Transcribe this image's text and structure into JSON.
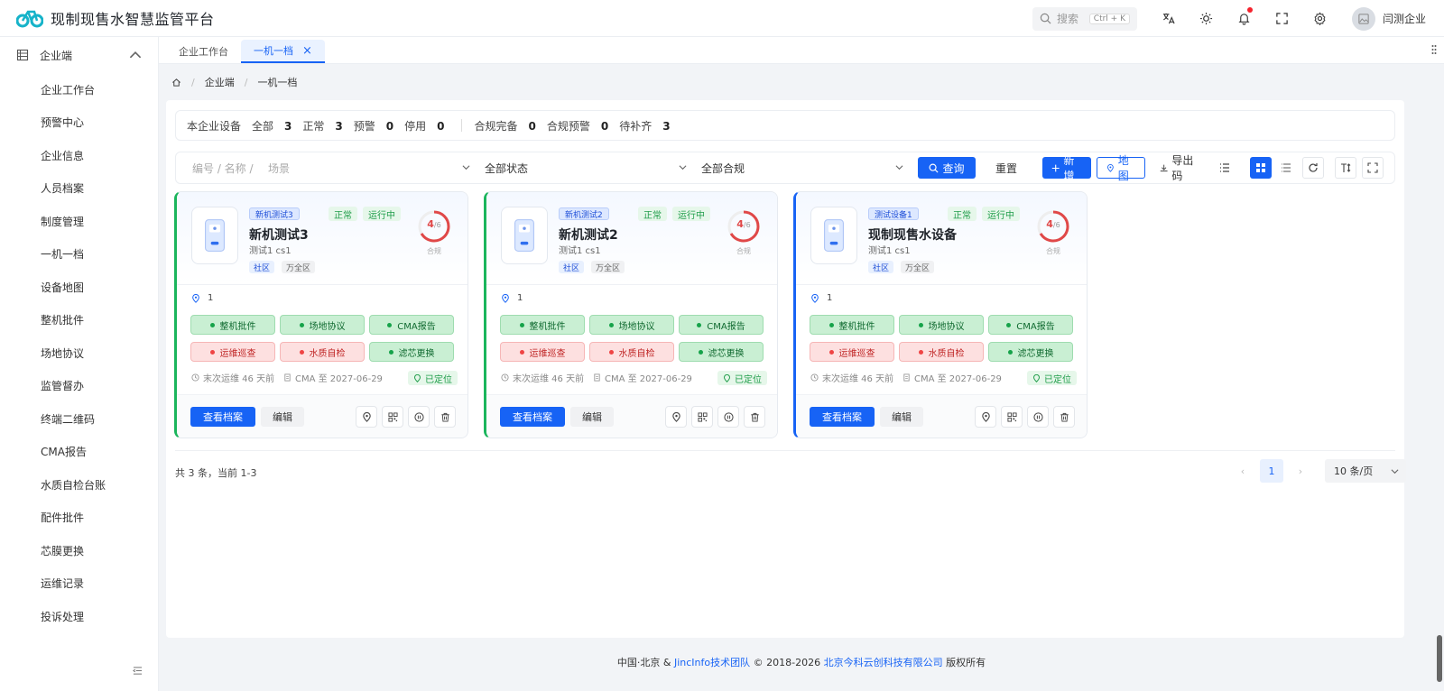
{
  "app": {
    "title": "现制现售水智慧监管平台",
    "brand_color": "#1763f5"
  },
  "header": {
    "search_placeholder": "搜索",
    "search_shortcut": "Ctrl + K",
    "icons": [
      "translate-icon",
      "theme-sun-icon",
      "bell-icon",
      "fullscreen-icon",
      "settings-gear-icon"
    ],
    "user_name": "闫测企业"
  },
  "sidebar": {
    "group_label": "企业端",
    "items": [
      "企业工作台",
      "预警中心",
      "企业信息",
      "人员档案",
      "制度管理",
      "一机一档",
      "设备地图",
      "整机批件",
      "场地协议",
      "监管督办",
      "终端二维码",
      "CMA报告",
      "水质自检台账",
      "配件批件",
      "芯膜更换",
      "运维记录",
      "投诉处理"
    ]
  },
  "tabs": [
    {
      "label": "企业工作台",
      "active": false
    },
    {
      "label": "一机一档",
      "active": true
    }
  ],
  "breadcrumb": {
    "items": [
      "企业端",
      "一机一档"
    ]
  },
  "stats": {
    "label": "本企业设备",
    "all_label": "全部",
    "all_value": "3",
    "normal_label": "正常",
    "normal_value": "3",
    "warn_label": "预警",
    "warn_value": "0",
    "stop_label": "停用",
    "stop_value": "0",
    "comp_ok_label": "合规完备",
    "comp_ok_value": "0",
    "comp_warn_label": "合规预警",
    "comp_warn_value": "0",
    "pending_label": "待补齐",
    "pending_value": "3"
  },
  "filter": {
    "code_placeholder": "编号 / 名称 /",
    "scene_placeholder": "场景",
    "status_value": "全部状态",
    "compliance_value": "全部合规",
    "query_label": "查询",
    "reset_label": "重置",
    "add_label": "新增",
    "map_label": "地图",
    "export_label": "导出码"
  },
  "cards": [
    {
      "chip": "新机测试3",
      "name": "新机测试3",
      "sub": "测试1 cs1",
      "status1": "正常",
      "status2": "运行中",
      "score": "4",
      "score_total": "/6",
      "score_label": "合规",
      "tag1": "社区",
      "tag2": "万全区",
      "location": "1",
      "b1": "整机批件",
      "b2": "场地协议",
      "b3": "CMA报告",
      "b4": "运维巡查",
      "b5": "水质自检",
      "b6": "滤芯更换",
      "maint": "末次运维 46 天前",
      "cma": "CMA 至 2027-06-29",
      "located": "已定位",
      "view": "查看档案",
      "edit": "编辑",
      "score_fraction": 0.667
    },
    {
      "chip": "新机测试2",
      "name": "新机测试2",
      "sub": "测试1 cs1",
      "status1": "正常",
      "status2": "运行中",
      "score": "4",
      "score_total": "/6",
      "score_label": "合规",
      "tag1": "社区",
      "tag2": "万全区",
      "location": "1",
      "b1": "整机批件",
      "b2": "场地协议",
      "b3": "CMA报告",
      "b4": "运维巡查",
      "b5": "水质自检",
      "b6": "滤芯更换",
      "maint": "末次运维 46 天前",
      "cma": "CMA 至 2027-06-29",
      "located": "已定位",
      "view": "查看档案",
      "edit": "编辑",
      "score_fraction": 0.667
    },
    {
      "chip": "测试设备1",
      "name": "现制现售水设备",
      "sub": "测试1 cs1",
      "status1": "正常",
      "status2": "运行中",
      "score": "4",
      "score_total": "/6",
      "score_label": "合规",
      "tag1": "社区",
      "tag2": "万全区",
      "location": "1",
      "b1": "整机批件",
      "b2": "场地协议",
      "b3": "CMA报告",
      "b4": "运维巡查",
      "b5": "水质自检",
      "b6": "滤芯更换",
      "maint": "末次运维 46 天前",
      "cma": "CMA 至 2027-06-29",
      "located": "已定位",
      "view": "查看档案",
      "edit": "编辑",
      "score_fraction": 0.667
    }
  ],
  "pagination": {
    "total_text": "共 3 条，当前 1-3",
    "current_page": "1",
    "page_size": "10 条/页"
  },
  "footer": {
    "prefix": "中国·北京 &",
    "team": "JincInfo技术团队",
    "copy": "© 2018-2026",
    "company": "北京今科云创科技有限公司",
    "suffix": "版权所有"
  }
}
